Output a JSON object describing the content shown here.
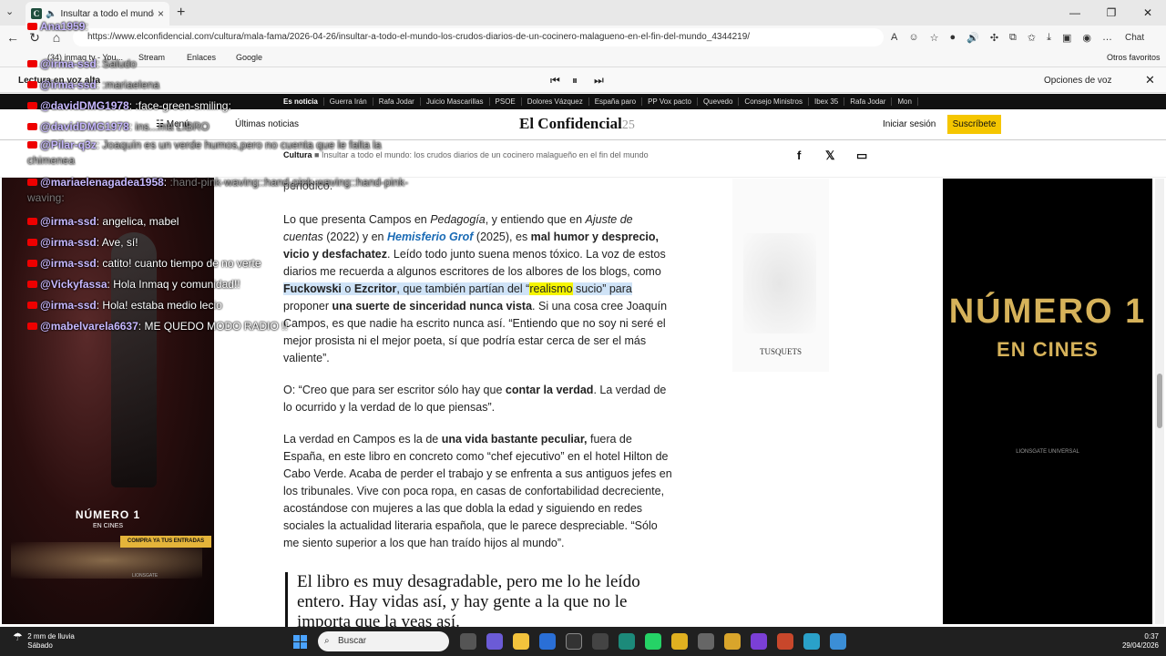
{
  "browser": {
    "tab_title": "Insultar a todo el mundo: los",
    "url": "https://www.elconfidencial.com/cultura/mala-fama/2026-04-26/insultar-a-todo-el-mundo-los-crudos-diarios-de-un-cocinero-malagueno-en-el-fin-del-mundo_4344219/",
    "chat_label": "Chat",
    "bookmarks": [
      "(34) inmaq tv - You...",
      "Stream",
      "Enlaces",
      "Google"
    ],
    "other_favorites": "Otros favoritos"
  },
  "read_aloud": {
    "title": "Lectura en voz alta",
    "voice_options": "Opciones de voz"
  },
  "site": {
    "topics": [
      "Es noticia",
      "Guerra Irán",
      "Rafa Jodar",
      "Juicio Mascarillas",
      "PSOE",
      "Dolores Vázquez",
      "España paro",
      "PP Vox pacto",
      "Quevedo",
      "Consejo Ministros",
      "Ibex 35",
      "Rafa Jodar",
      "Mon"
    ],
    "menu": "Menú",
    "latest": "Últimas noticias",
    "logo": "El Confidencial",
    "logo_years": "25",
    "login": "Iniciar sesión",
    "subscribe": "Suscríbete",
    "section": "Cultura",
    "headline": "Insultar a todo el mundo: los crudos diarios de un cocinero malagueño en el fin del mundo"
  },
  "article": {
    "lead_fragment": "periódico.",
    "p1_a": "Lo que presenta Campos en ",
    "p1_b": "Pedagogía",
    "p1_c": ", y entiendo que en ",
    "p1_d": "Ajuste de cuentas",
    "p1_e": " (2022) y en ",
    "p1_f": "Hemisferio Grof",
    "p1_g": " (2025), es ",
    "p1_h": "mal humor y desprecio, vicio y desfachatez",
    "p1_i": ". Leído todo junto suena menos tóxico. La voz de estos diarios me recuerda a algunos escritores de los albores de los blogs, como ",
    "p1_j": "Fuckowski",
    "p1_k": " o ",
    "p1_l": "Ezcritor",
    "p1_m": ", que también partían del “",
    "p1_n": "realismo",
    "p1_o": " sucio” para",
    "p1_p": " proponer ",
    "p1_q": "una suerte de sinceridad nunca vista",
    "p1_r": ". Si una cosa cree Joaquín Campos, es que nadie ha escrito nunca así. “Entiendo que no soy ni seré el mejor prosista ni el mejor poeta, sí que podría estar cerca de ser el más valiente”.",
    "p2_a": "O: “Creo que para ser escritor sólo hay que ",
    "p2_b": "contar la verdad",
    "p2_c": ". La verdad de lo ocurrido y la verdad de lo que piensas”.",
    "p3_a": "La verdad en Campos es la de ",
    "p3_b": "una vida bastante peculiar,",
    "p3_c": " fuera de España, en este libro en concreto como “chef ejecutivo” en el hotel Hilton de Cabo Verde. Acaba de perder el trabajo y se enfrenta a sus antiguos jefes en los tribunales. Vive con poca ropa, en casas de confortabilidad decreciente, acostándose con mujeres a las que dobla la edad y siguiendo en redes sociales la actualidad literaria española, que le parece despreciable. “Sólo me siento superior a los que han traído hijos al mundo”.",
    "quote": "El libro es muy desagradable, pero me lo he leído entero. Hay vidas así, y hay gente a la que no le importa que la veas así."
  },
  "ads": {
    "left_title": "NÚMERO 1",
    "left_sub": "EN CINES",
    "left_cta": "COMPRA YA TUS ENTRADAS",
    "left_brand": "LIONSGATE",
    "side_brand": "TUSQUETS",
    "right_title": "NÚMERO 1",
    "right_sub": "EN CINES",
    "right_brand": "LIONSGATE   UNIVERSAL"
  },
  "chat": [
    {
      "user": "Ana1959",
      "text": ""
    },
    {
      "user": "@irma-ssd",
      "text": "Saludo"
    },
    {
      "user": "@irma-ssd",
      "text": ":mariaelena"
    },
    {
      "user": "@davidDMG1978",
      "text": ":face-green-smiling:"
    },
    {
      "user": "@davidDMG1978",
      "text": "ins...ma LIBRO"
    },
    {
      "user": "@Pilar-q3z",
      "text": "Joaquín es un verde humos,pero no cuenta que le falta la chimenea"
    },
    {
      "user": "@mariaelenagadea1958",
      "text": ":hand-pink-waving::hand-pink-waving::hand-pink-waving:"
    },
    {
      "user": "@irma-ssd",
      "text": "angelica, mabel"
    },
    {
      "user": "@irma-ssd",
      "text": "Ave, sí!"
    },
    {
      "user": "@irma-ssd",
      "text": "catito! cuanto tiempo de no verte"
    },
    {
      "user": "@Vickyfassa",
      "text": "Hola Inmaq y comunidad!!"
    },
    {
      "user": "@irma-ssd",
      "text": "Hola! estaba medio lecio"
    },
    {
      "user": "@mabelvarela6637",
      "text": "ME QUEDO MODO RADIO !!"
    }
  ],
  "taskbar": {
    "weather_line1": "2 mm de lluvia",
    "weather_line2": "Sábado",
    "search": "Buscar",
    "time": "0:37",
    "date": "29/04/2026"
  }
}
